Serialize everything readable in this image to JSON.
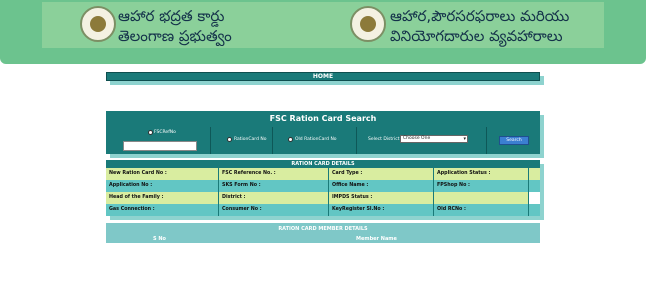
{
  "header": {
    "title_left": "ఆహార భద్రత కార్డు",
    "subtitle_left": "తెలంగాణ ప్రభుత్వం",
    "title_right": "ఆహార,పౌరసరఫరాలు మరియు",
    "subtitle_right": "వినియోగదారుల వ్యవహారాలు",
    "background": "#6cc38e"
  },
  "nav": {
    "home_label": "HOME"
  },
  "search": {
    "title": "FSC Ration Card Search",
    "options": [
      "FSCRefNo",
      "RationCard No",
      "Old RationCard No"
    ],
    "district_label": "Select District :",
    "district_selected": "Choose One",
    "button_label": "Search",
    "fsc_value": ""
  },
  "ration_details": {
    "title": "RATION CARD DETAILS",
    "rows": [
      [
        "New Ration Card No :",
        "FSC Reference No. :",
        "Card Type :",
        "Application Status :"
      ],
      [
        "Application No :",
        "SKS Form No :",
        "Office Name :",
        "FPShop No :"
      ],
      [
        "Head of the Family :",
        "District :",
        "IMPDS Status :",
        ""
      ],
      [
        "Gas Connection :",
        "Consumer No :",
        "KeyRegister Sl.No :",
        "Old RCNo :"
      ]
    ]
  },
  "members": {
    "title": "RATION CARD MEMBER DETAILS",
    "columns": [
      "S No",
      "Member Name"
    ]
  },
  "colors": {
    "teal": "#1a7a79",
    "light_row": "#d9eda0",
    "alt_row": "#62c6c4",
    "button": "#3b7fd1"
  }
}
